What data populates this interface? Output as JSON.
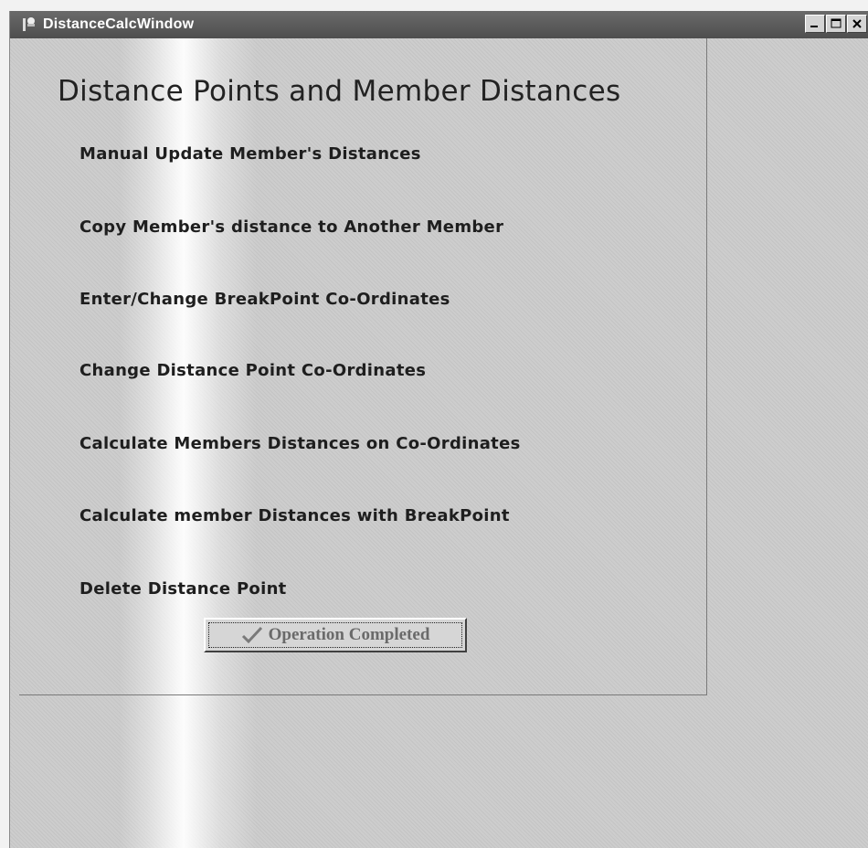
{
  "window": {
    "title": "DistanceCalcWindow",
    "controls": [
      "minimize-icon",
      "maximize-icon",
      "close-icon"
    ]
  },
  "heading": "Distance Points and Member Distances",
  "menu": [
    {
      "label": "Manual Update Member's Distances"
    },
    {
      "label": "Copy Member's distance to Another Member"
    },
    {
      "label": "Enter/Change BreakPoint Co-Ordinates"
    },
    {
      "label": "Change Distance Point Co-Ordinates"
    },
    {
      "label": "Calculate Members Distances on Co-Ordinates"
    },
    {
      "label": "Calculate member Distances with  BreakPoint"
    },
    {
      "label": "Delete Distance Point"
    }
  ],
  "status_button": {
    "label": "Operation Completed",
    "icon": "checkmark-icon"
  }
}
